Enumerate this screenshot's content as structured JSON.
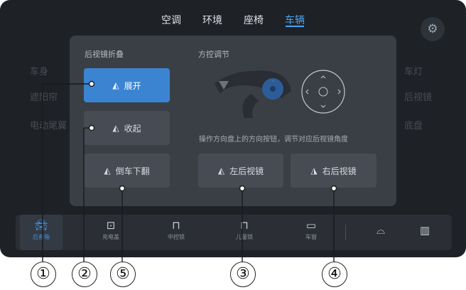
{
  "tabs": [
    "空调",
    "环境",
    "座椅",
    "车辆"
  ],
  "active_tab": "车辆",
  "bg_left": [
    "车身",
    "遮阳帘",
    "电动尾翼"
  ],
  "bg_right": [
    "车灯",
    "后视镜",
    "底盘"
  ],
  "fold_section": {
    "title": "后视镜折叠",
    "expand_label": "展开",
    "fold_label": "收起",
    "reverse_label": "倒车下翻"
  },
  "steer_section": {
    "title": "方控调节",
    "hint": "操作方向盘上的方向按钮，调节对应后视镜角度",
    "left_mirror_label": "左后视镜",
    "right_mirror_label": "右后视镜"
  },
  "bottom_bar": {
    "trunk": "后备箱",
    "charge_port": "充电盖",
    "central_lock": "中控锁",
    "child_lock": "儿童锁",
    "window": "车窗"
  },
  "callouts": [
    "①",
    "②",
    "⑤",
    "③",
    "④"
  ],
  "colors": {
    "accent": "#3b84d2",
    "panel": "#3a3f46",
    "screen": "#1e2126"
  }
}
